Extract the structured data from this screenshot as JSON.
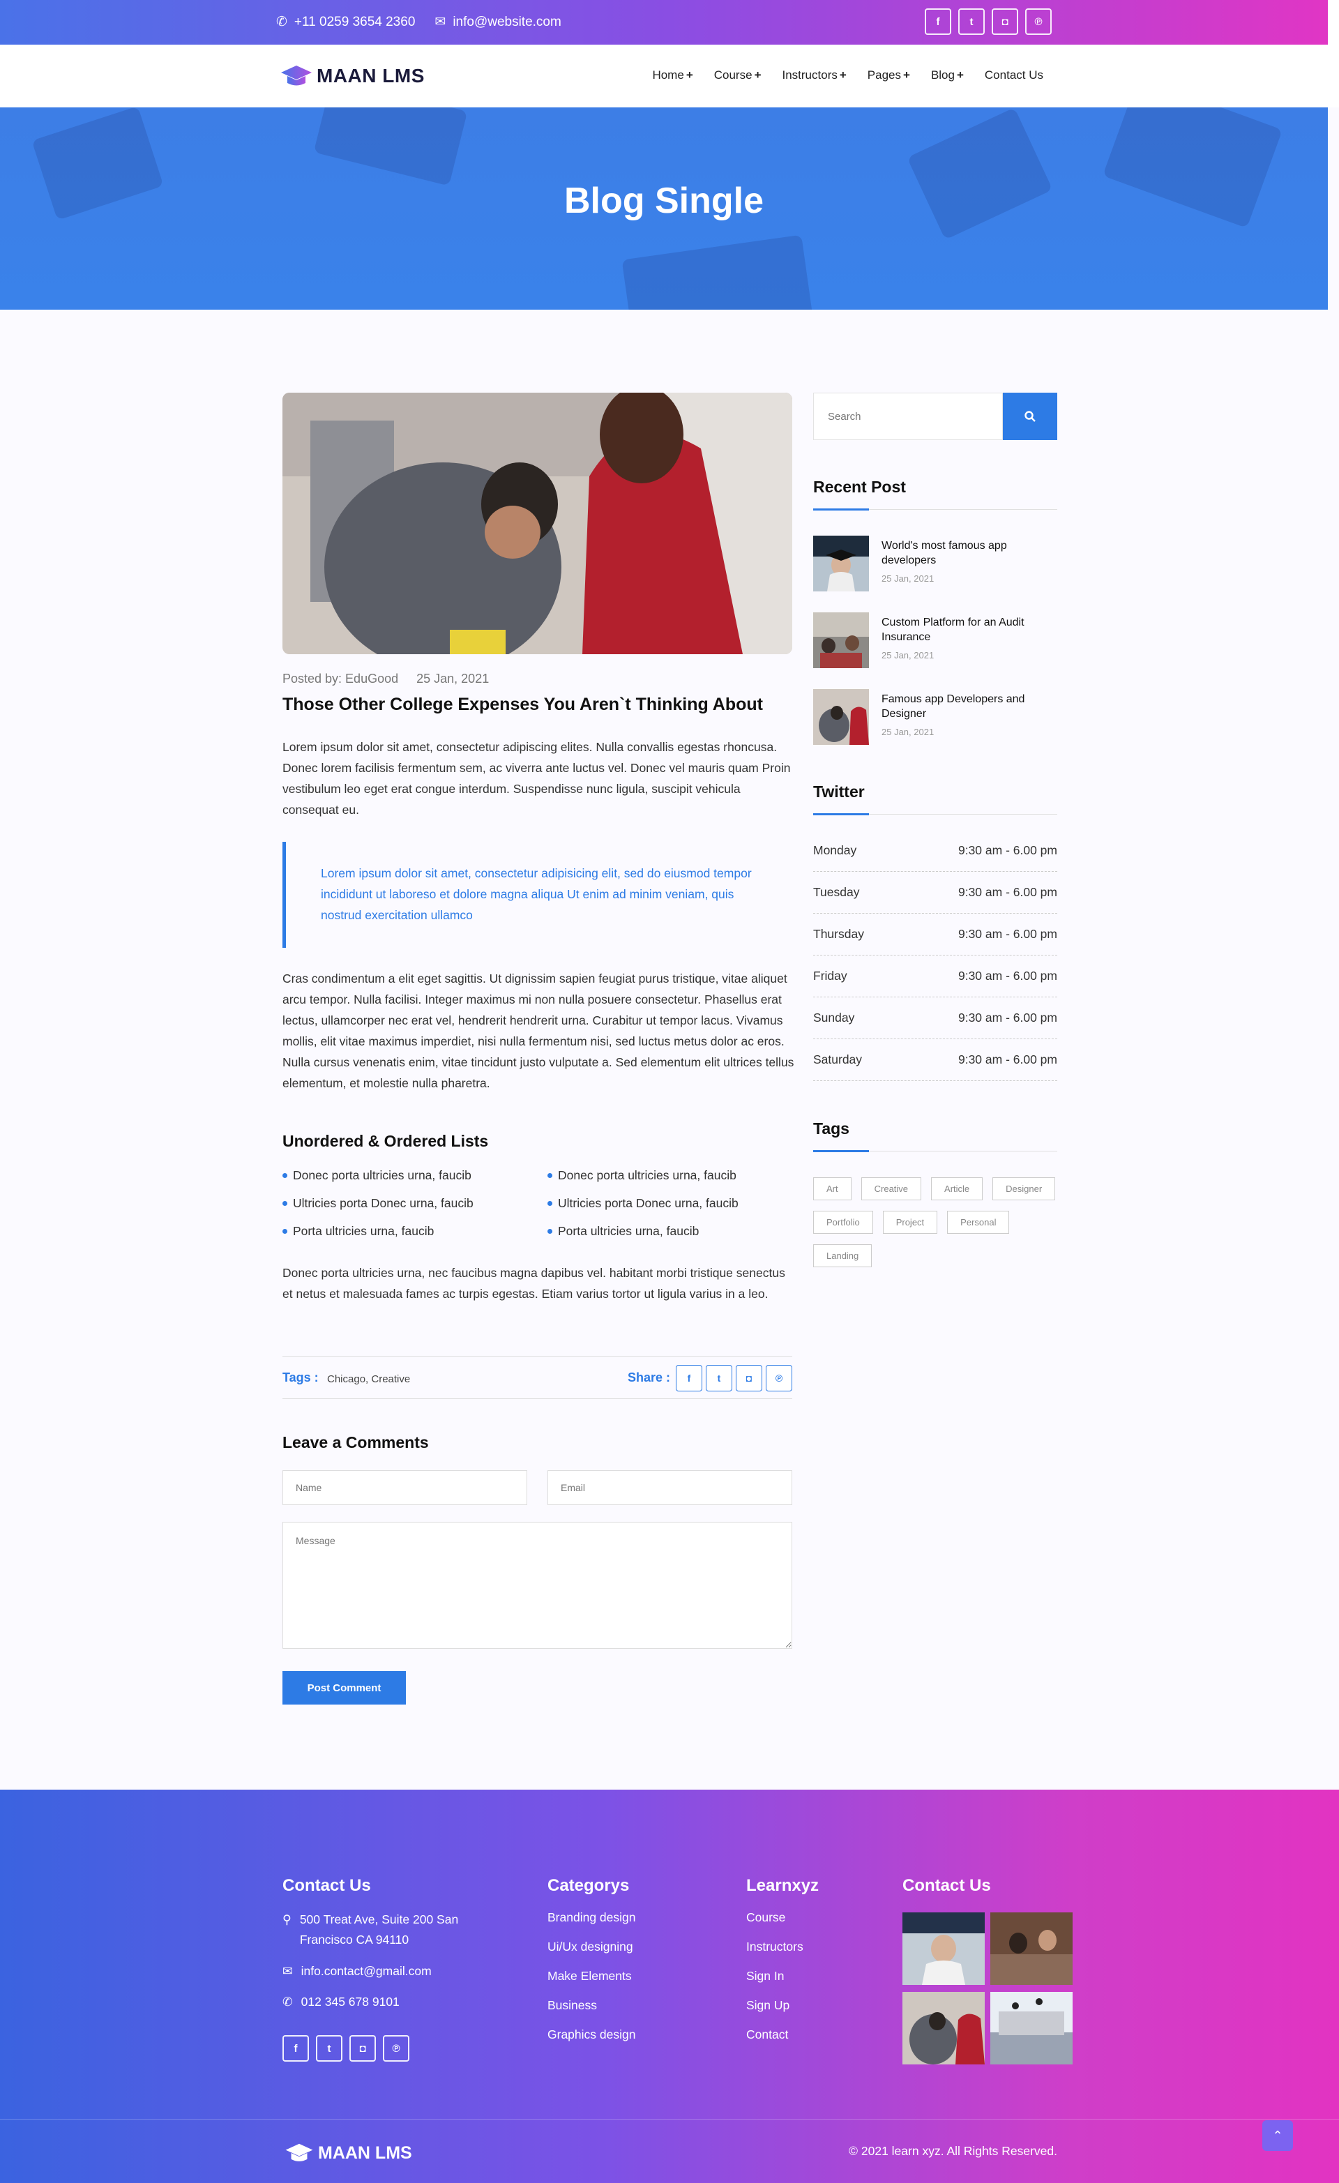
{
  "topbar": {
    "phone": "+11 0259 3654 2360",
    "email": "info@website.com",
    "socials": [
      {
        "icon": "facebook-icon",
        "glyph": "f"
      },
      {
        "icon": "twitter-icon",
        "glyph": "t"
      },
      {
        "icon": "instagram-icon",
        "glyph": "◘"
      },
      {
        "icon": "pinterest-icon",
        "glyph": "℗"
      }
    ]
  },
  "nav": {
    "brand": "MAAN LMS",
    "items": [
      {
        "label": "Home",
        "has_sub": true
      },
      {
        "label": "Course",
        "has_sub": true
      },
      {
        "label": "Instructors",
        "has_sub": true
      },
      {
        "label": "Pages",
        "has_sub": true
      },
      {
        "label": "Blog",
        "has_sub": true
      },
      {
        "label": "Contact Us",
        "has_sub": false
      }
    ]
  },
  "hero": {
    "title": "Blog Single"
  },
  "post": {
    "posted_by": "Posted by: EduGood",
    "date": "25 Jan, 2021",
    "title": "Those Other College Expenses You Aren`t Thinking About",
    "intro": "Lorem ipsum dolor sit amet, consectetur adipiscing elites. Nulla convallis egestas rhoncusa. Donec lorem facilisis fermentum sem, ac viverra ante luctus vel. Donec vel mauris quam Proin vestibulum leo eget erat congue interdum. Suspendisse nunc ligula, suscipit vehicula consequat eu.",
    "quote": "Lorem ipsum dolor sit amet, consectetur adipisicing elit, sed do eiusmod tempor incididunt ut laboreso et dolore magna aliqua Ut enim ad minim veniam, quis nostrud exercitation ullamco",
    "body": "Cras condimentum a elit eget sagittis. Ut dignissim sapien feugiat purus tristique, vitae aliquet arcu tempor. Nulla facilisi. Integer maximus mi non nulla posuere consectetur. Phasellus erat lectus, ullamcorper nec erat vel, hendrerit hendrerit urna. Curabitur ut tempor lacus. Vivamus mollis, elit vitae maximus imperdiet, nisi nulla fermentum nisi, sed luctus metus dolor ac eros. Nulla cursus venenatis enim, vitae tincidunt justo vulputate a. Sed elementum elit ultrices tellus elementum, et molestie nulla pharetra.",
    "lists_title": "Unordered & Ordered Lists",
    "list_items": [
      "Donec porta ultricies urna, faucib",
      "Donec porta ultricies urna, faucib",
      "Ultricies porta Donec urna, faucib",
      "Ultricies porta Donec urna, faucib",
      "Porta ultricies urna, faucib",
      "Porta ultricies urna, faucib"
    ],
    "closing": "Donec porta ultricies urna, nec faucibus magna dapibus vel. habitant morbi tristique senectus et netus et malesuada fames ac turpis egestas. Etiam varius tortor ut ligula varius in a leo.",
    "tags_label": "Tags :",
    "tags_value": "Chicago, Creative",
    "share_label": "Share :"
  },
  "comments": {
    "title": "Leave a Comments",
    "name_placeholder": "Name",
    "email_placeholder": "Email",
    "message_placeholder": "Message",
    "submit": "Post Comment"
  },
  "sidebar": {
    "search_placeholder": "Search",
    "recent_title": "Recent Post",
    "recent": [
      {
        "title": "World's most famous app developers",
        "date": "25 Jan, 2021"
      },
      {
        "title": "Custom Platform for an Audit Insurance",
        "date": "25 Jan, 2021"
      },
      {
        "title": "Famous app Developers and Designer",
        "date": "25 Jan, 2021"
      }
    ],
    "twitter_title": "Twitter",
    "hours": [
      {
        "day": "Monday",
        "time": "9:30 am - 6.00 pm"
      },
      {
        "day": "Tuesday",
        "time": "9:30 am - 6.00 pm"
      },
      {
        "day": "Thursday",
        "time": "9:30 am - 6.00 pm"
      },
      {
        "day": "Friday",
        "time": "9:30 am - 6.00 pm"
      },
      {
        "day": "Sunday",
        "time": "9:30 am - 6.00 pm"
      },
      {
        "day": "Saturday",
        "time": "9:30 am - 6.00 pm"
      }
    ],
    "tags_title": "Tags",
    "tags": [
      "Art",
      "Creative",
      "Article",
      "Designer",
      "Portfolio",
      "Project",
      "Personal",
      "Landing"
    ]
  },
  "footer": {
    "contact_title": "Contact Us",
    "address": "500 Treat Ave, Suite 200 San Francisco CA 94110",
    "email": "info.contact@gmail.com",
    "phone": "012 345 678 9101",
    "categories_title": "Categorys",
    "categories": [
      "Branding design",
      "Ui/Ux designing",
      "Make Elements",
      "Business",
      "Graphics design"
    ],
    "learn_title": "Learnxyz",
    "learn_links": [
      "Course",
      "Instructors",
      "Sign In",
      "Sign Up",
      "Contact"
    ],
    "gallery_title": "Contact Us",
    "brand": "MAAN LMS",
    "copyright": "© 2021 learn xyz. All Rights Reserved."
  },
  "colors": {
    "accent": "#2d7be5",
    "gradient_start": "#3b63e0",
    "gradient_end": "#e233c2"
  }
}
